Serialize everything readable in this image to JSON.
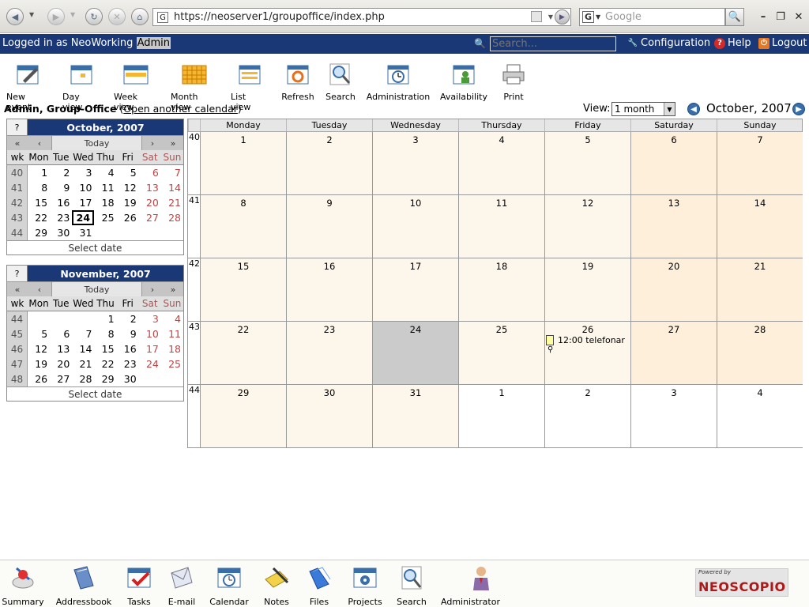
{
  "browser": {
    "url": "https://neoserver1/groupoffice/index.php",
    "search_placeholder": "Google"
  },
  "header": {
    "logged_in_prefix": "Logged in as NeoWorking",
    "user": "Admin",
    "search_placeholder": "Search...",
    "configuration": "Configuration",
    "help": "Help",
    "logout": "Logout"
  },
  "toolbar": {
    "new_event": "New event",
    "day_view": "Day view",
    "week_view": "Week view",
    "month_view": "Month view",
    "list_view": "List view",
    "refresh": "Refresh",
    "search": "Search",
    "administration": "Administration",
    "availability": "Availability",
    "print": "Print"
  },
  "calendar": {
    "owner": "Admin, Group-Office",
    "open_other_prefix": "(",
    "open_other": "Open another calendar",
    "open_other_suffix": ")",
    "view_label": "View:",
    "view_value": "1 month",
    "period_title": "October, 2007",
    "weekday_headers": [
      "Monday",
      "Tuesday",
      "Wednesday",
      "Thursday",
      "Friday",
      "Saturday",
      "Sunday"
    ],
    "weeks": [
      {
        "wk": "40",
        "days": [
          "1",
          "2",
          "3",
          "4",
          "5",
          "6",
          "7"
        ]
      },
      {
        "wk": "41",
        "days": [
          "8",
          "9",
          "10",
          "11",
          "12",
          "13",
          "14"
        ]
      },
      {
        "wk": "42",
        "days": [
          "15",
          "16",
          "17",
          "18",
          "19",
          "20",
          "21"
        ]
      },
      {
        "wk": "43",
        "days": [
          "22",
          "23",
          "24",
          "25",
          "26",
          "27",
          "28"
        ]
      },
      {
        "wk": "44",
        "days": [
          "29",
          "30",
          "31",
          "1",
          "2",
          "3",
          "4"
        ]
      }
    ],
    "event": {
      "time_title": "12:00 telefonar"
    }
  },
  "minical_common": {
    "q": "?",
    "first": "«",
    "prev": "‹",
    "today": "Today",
    "next": "›",
    "last": "»",
    "wk_head": "wk",
    "days_head": [
      "Mon",
      "Tue",
      "Wed",
      "Thu",
      "Fri",
      "Sat",
      "Sun"
    ],
    "select_date": "Select date"
  },
  "minical_oct": {
    "title": "October, 2007",
    "rows": [
      {
        "wk": "40",
        "days": [
          "1",
          "2",
          "3",
          "4",
          "5",
          "6",
          "7"
        ]
      },
      {
        "wk": "41",
        "days": [
          "8",
          "9",
          "10",
          "11",
          "12",
          "13",
          "14"
        ]
      },
      {
        "wk": "42",
        "days": [
          "15",
          "16",
          "17",
          "18",
          "19",
          "20",
          "21"
        ]
      },
      {
        "wk": "43",
        "days": [
          "22",
          "23",
          "24",
          "25",
          "26",
          "27",
          "28"
        ]
      },
      {
        "wk": "44",
        "days": [
          "29",
          "30",
          "31",
          "",
          "",
          "",
          ""
        ]
      }
    ]
  },
  "minical_nov": {
    "title": "November, 2007",
    "rows": [
      {
        "wk": "44",
        "days": [
          "",
          "",
          "",
          "1",
          "2",
          "3",
          "4"
        ]
      },
      {
        "wk": "45",
        "days": [
          "5",
          "6",
          "7",
          "8",
          "9",
          "10",
          "11"
        ]
      },
      {
        "wk": "46",
        "days": [
          "12",
          "13",
          "14",
          "15",
          "16",
          "17",
          "18"
        ]
      },
      {
        "wk": "47",
        "days": [
          "19",
          "20",
          "21",
          "22",
          "23",
          "24",
          "25"
        ]
      },
      {
        "wk": "48",
        "days": [
          "26",
          "27",
          "28",
          "29",
          "30",
          "",
          ""
        ]
      }
    ]
  },
  "bottom": {
    "summary": "Summary",
    "addressbook": "Addressbook",
    "tasks": "Tasks",
    "email": "E-mail",
    "calendar": "Calendar",
    "notes": "Notes",
    "files": "Files",
    "projects": "Projects",
    "search": "Search",
    "admin_menu": "Administrator menu",
    "brand_small": "Powered by",
    "brand": "NEOSCOPIO"
  }
}
